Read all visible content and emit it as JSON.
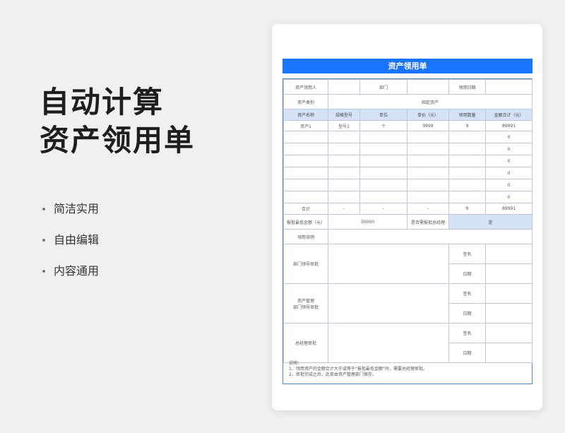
{
  "promo": {
    "title_line1": "自动计算",
    "title_line2": "资产领用单",
    "features": [
      "简洁实用",
      "自由编辑",
      "内容通用"
    ]
  },
  "form": {
    "title": "资产领用单",
    "row1": {
      "label_person": "资产领用人",
      "value_person": "",
      "label_dept": "部门",
      "value_dept": "",
      "label_date": "领用日期",
      "value_date": ""
    },
    "row2": {
      "label_category": "资产类别",
      "value_category": "固定资产"
    },
    "columns": [
      "资产名称",
      "规格型号",
      "单位",
      "单价（元）",
      "领用数量",
      "金额合计（元）"
    ],
    "items": [
      [
        "资产1",
        "型号1",
        "个",
        "9999",
        "9",
        "89991"
      ],
      [
        "",
        "",
        "",
        "",
        "",
        "0"
      ],
      [
        "",
        "",
        "",
        "",
        "",
        "0"
      ],
      [
        "",
        "",
        "",
        "",
        "",
        "0"
      ],
      [
        "",
        "",
        "",
        "",
        "",
        "0"
      ],
      [
        "",
        "",
        "",
        "",
        "",
        "0"
      ],
      [
        "",
        "",
        "",
        "",
        "",
        "0"
      ]
    ],
    "total": [
      "合计",
      "-",
      "-",
      "-",
      "9",
      "89991"
    ],
    "threshold": {
      "label": "报批最低金额（元）",
      "value": "50000",
      "question": "是否需报批总经理",
      "answer": "是"
    },
    "usage_label": "领用说明",
    "approvals": [
      {
        "label_line1": "部门领导审批",
        "label_line2": "",
        "sign": "签名",
        "date": "日期"
      },
      {
        "label_line1": "资产管理",
        "label_line2": "部门领导审批",
        "sign": "签名",
        "date": "日期"
      },
      {
        "label_line1": "总经理审批",
        "label_line2": "",
        "sign": "签名",
        "date": "日期"
      }
    ],
    "notes": {
      "heading": "说明：",
      "line1": "1、领用资产的金额合计大于或等于“报批最低金额”时，需要总经理审批。",
      "line2": "2、审批完成之后，此单由资产管理部门保存。"
    }
  },
  "colors": {
    "accent": "#1a74ff",
    "header_fill": "#d5e3f7",
    "border": "#4a86d0"
  }
}
